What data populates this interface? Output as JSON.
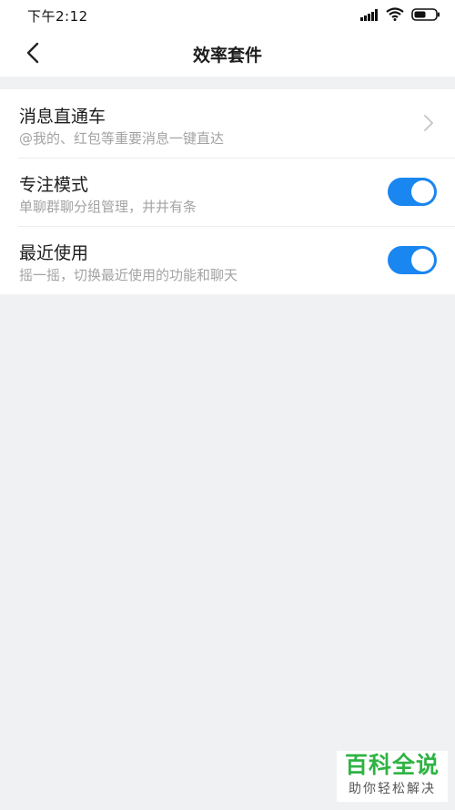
{
  "status_bar": {
    "time": "下午2:12",
    "icons": [
      "signal-icon",
      "wifi-icon",
      "battery-icon"
    ]
  },
  "header": {
    "title": "效率套件",
    "back_icon": "back-chevron-icon"
  },
  "settings": {
    "items": [
      {
        "title": "消息直通车",
        "subtitle": "@我的、红包等重要消息一键直达",
        "control": "chevron-right-icon"
      },
      {
        "title": "专注模式",
        "subtitle": "单聊群聊分组管理，井井有条",
        "control": "toggle",
        "enabled": true
      },
      {
        "title": "最近使用",
        "subtitle": "摇一摇，切换最近使用的功能和聊天",
        "control": "toggle",
        "enabled": true
      }
    ]
  },
  "watermark": {
    "main": "百科全说",
    "sub": "助你轻松解决"
  },
  "colors": {
    "accent": "#1a86f0",
    "background": "#f0f1f3",
    "card": "#ffffff",
    "subtitle": "#a3a3a3",
    "watermark_green": "#2fb344"
  }
}
